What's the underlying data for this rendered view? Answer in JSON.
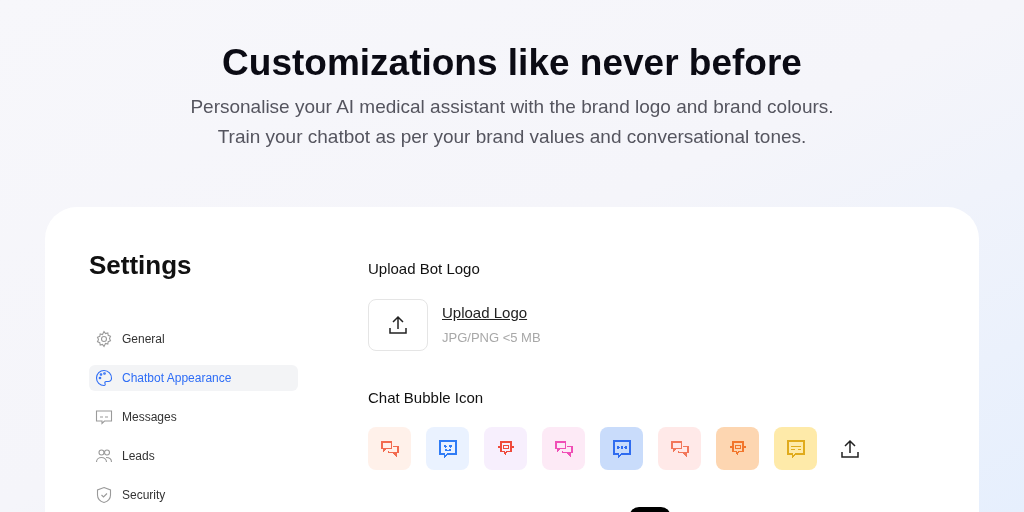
{
  "hero": {
    "title": "Customizations like never before",
    "subtitle_lines": [
      "Personalise your AI medical assistant with the brand logo and brand colours.",
      "Train your chatbot as per your brand values and conversational tones."
    ]
  },
  "settings": {
    "title": "Settings",
    "nav": [
      {
        "label": "General",
        "kind": "gear",
        "selected": false
      },
      {
        "label": "Chatbot Appearance",
        "kind": "palette",
        "selected": true
      },
      {
        "label": "Messages",
        "kind": "message",
        "selected": false
      },
      {
        "label": "Leads",
        "kind": "people",
        "selected": false
      },
      {
        "label": "Security",
        "kind": "shield",
        "selected": false
      }
    ]
  },
  "upload_logo": {
    "heading": "Upload Bot Logo",
    "link": "Upload Logo",
    "hint": "JPG/PNG <5 MB"
  },
  "chat_bubble_icon": {
    "heading": "Chat Bubble Icon",
    "options": [
      {
        "color": "#fff1ea",
        "icon": {
          "kind": "double",
          "color": "#f26b4f"
        }
      },
      {
        "color": "#eaf2ff",
        "icon": {
          "kind": "smile",
          "color": "#2f7cf6"
        }
      },
      {
        "color": "#f7effd",
        "icon": {
          "kind": "robot",
          "color": "#ef4a3c"
        }
      },
      {
        "color": "#fdeaf6",
        "icon": {
          "kind": "double",
          "color": "#f04fb6"
        }
      },
      {
        "color": "#c9dcfb",
        "icon": {
          "kind": "dots",
          "color": "#2f6cf0"
        }
      },
      {
        "color": "#ffe9e8",
        "icon": {
          "kind": "double",
          "color": "#f2775a"
        }
      },
      {
        "color": "#fdd6b1",
        "icon": {
          "kind": "robot",
          "color": "#f2762c"
        }
      },
      {
        "color": "#feeaa9",
        "icon": {
          "kind": "lines",
          "color": "#e0ab1c"
        }
      }
    ]
  }
}
